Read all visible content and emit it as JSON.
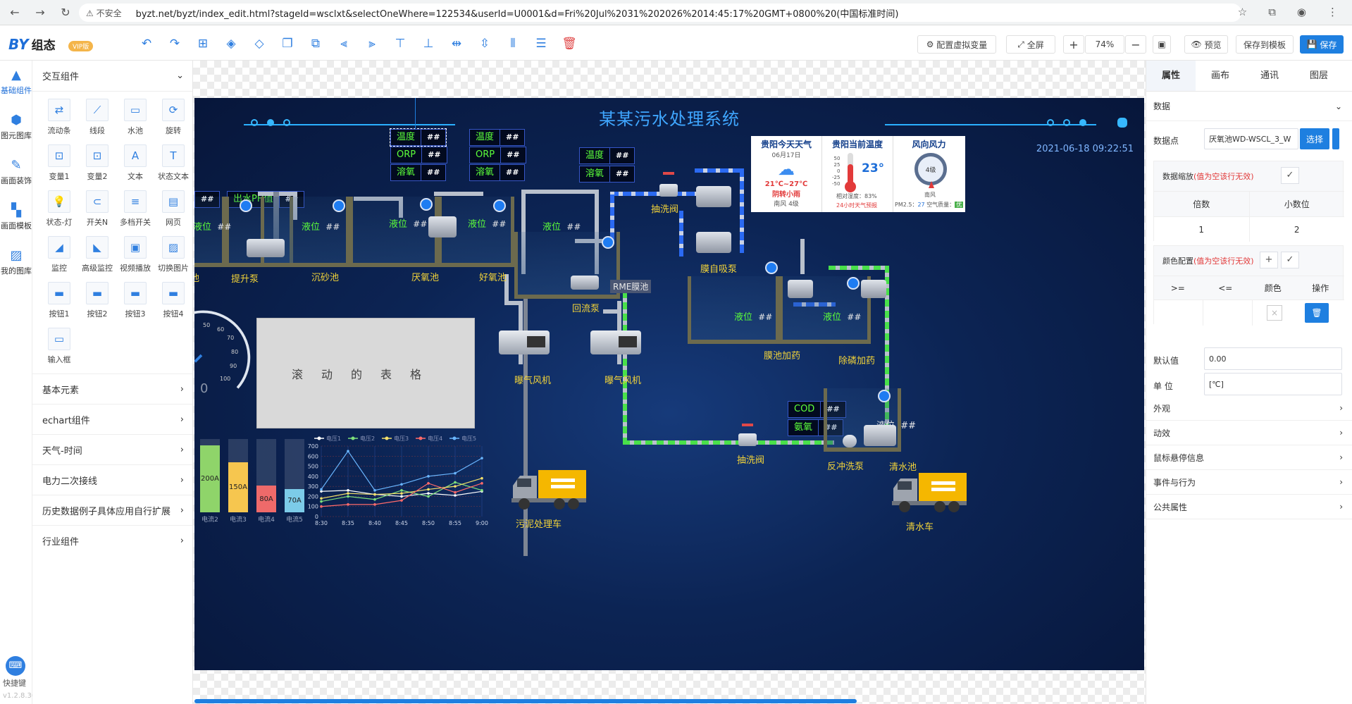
{
  "browser": {
    "back": "←",
    "forward": "→",
    "reload": "↻",
    "insecure": "不安全",
    "url": "byzt.net/byzt/index_edit.html?stageId=wsclxt&selectOneWhere=122534&userId=U0001&d=Fri%20Jul%2031%202026%2014:45:17%20GMT+0800%20(中国标准时间)"
  },
  "toolbar": {
    "logo": "BY",
    "logo_suffix": "组态",
    "vip": "VIP版",
    "virtual_vars": "配置虚拟变量",
    "fullscreen": "全屏",
    "zoom_in": "+",
    "zoom": "74%",
    "zoom_out": "−",
    "preview": "预览",
    "save_template": "保存到模板",
    "save": "保存"
  },
  "rail": [
    {
      "label": "基础组件",
      "icon": "triangle-icon"
    },
    {
      "label": "图元图库",
      "icon": "cube-icon"
    },
    {
      "label": "画面装饰",
      "icon": "brush-icon"
    },
    {
      "label": "画面模板",
      "icon": "template-icon"
    },
    {
      "label": "我的图库",
      "icon": "image-icon"
    }
  ],
  "shortcut": "快捷键",
  "version": "v1.2.8.36",
  "palette": {
    "header": "交互组件",
    "items": [
      "流动条",
      "线段",
      "水池",
      "旋转",
      "变量1",
      "变量2",
      "文本",
      "状态文本",
      "状态-灯",
      "开关N",
      "多档开关",
      "网页",
      "监控",
      "高级监控",
      "视频播放",
      "切换图片",
      "按钮1",
      "按钮2",
      "按钮3",
      "按钮4",
      "输入框"
    ],
    "sections": [
      "基本元素",
      "echart组件",
      "天气-时间",
      "电力二次接线",
      "历史数据例子具体应用自行扩展",
      "行业组件"
    ]
  },
  "scada": {
    "title": "某某污水处理系统",
    "datetime": "2021-06-18  09:22:51",
    "placeholder": "##",
    "tags": {
      "temp": "温度",
      "orp": "ORP",
      "do": "溶氧",
      "ph": "出水PH值",
      "cod": "COD",
      "nh": "氨氧"
    },
    "level": "液位",
    "basins": [
      "池",
      "提升泵",
      "沉砂池",
      "厌氧池",
      "好氧池",
      "回流泵",
      "RME膜池",
      "膜自吸泵",
      "膜池加药",
      "除磷加药",
      "清水池",
      "抽洗阀",
      "抽洗阀",
      "反冲洗泵"
    ],
    "blowers": [
      "曝气风机",
      "曝气风机"
    ],
    "sludge": "污泥",
    "rolling": "滚动的表格",
    "gauge_zero": "0",
    "gauge_ticks": [
      "50",
      "60",
      "70",
      "80",
      "90",
      "100"
    ],
    "trucks": [
      "污泥处理车",
      "清水车"
    ],
    "weather": {
      "today_title": "贵阳今天天气",
      "today_date": "06月17日",
      "today_temp": "21℃~27℃",
      "today_desc": "阴转小雨",
      "today_wind": "南风 4级",
      "now_title": "贵阳当前温度",
      "now_temp": "23°",
      "humidity": "相对湿度：83%",
      "warning": "24小时天气预报",
      "wind_title": "风向风力",
      "wind_level": "4级",
      "wind_dir": "南风",
      "pm": "PM2.5：",
      "pm_val": "27",
      "aq": "空气质量：",
      "aq_val": "优",
      "therm_ticks": [
        "50",
        "25",
        "0",
        "-25",
        "-50"
      ]
    }
  },
  "bar_chart": {
    "categories": [
      "电流2",
      "电流3",
      "电流4",
      "电流5"
    ],
    "values": [
      "200A",
      "150A",
      "80A",
      "70A"
    ],
    "colors": [
      "#8fd46a",
      "#f6c64f",
      "#ee6a6a",
      "#7ccbe8"
    ]
  },
  "chart_data": {
    "type": "line",
    "x": [
      "8:30",
      "8:35",
      "8:40",
      "8:45",
      "8:50",
      "8:55",
      "9:00"
    ],
    "ylim": [
      0,
      700
    ],
    "yticks": [
      "700",
      "600",
      "500",
      "400",
      "300",
      "200",
      "100",
      "0"
    ],
    "series": [
      {
        "name": "电压1",
        "color": "#ffffff",
        "values": [
          250,
          260,
          220,
          200,
          230,
          210,
          250
        ]
      },
      {
        "name": "电压2",
        "color": "#7ee07b",
        "values": [
          150,
          200,
          170,
          260,
          200,
          340,
          260
        ]
      },
      {
        "name": "电压3",
        "color": "#f4e06a",
        "values": [
          180,
          230,
          220,
          230,
          270,
          300,
          380
        ]
      },
      {
        "name": "电压4",
        "color": "#ff6a6a",
        "values": [
          100,
          120,
          120,
          160,
          330,
          240,
          330
        ]
      },
      {
        "name": "电压5",
        "color": "#6ab6ff",
        "values": [
          270,
          650,
          260,
          320,
          400,
          430,
          580
        ]
      }
    ]
  },
  "rpanel": {
    "tabs": [
      "属性",
      "画布",
      "通讯",
      "图层"
    ],
    "data_section": "数据",
    "datapoint_label": "数据点",
    "datapoint_value": "厌氧池WD-WSCL_3_W",
    "select_btn": "选择",
    "scale_label": "数据缩放",
    "scale_note": "(值为空该行无效)",
    "col_mult": "倍数",
    "col_dec": "小数位",
    "mult_val": "1",
    "dec_val": "2",
    "color_label": "颜色配置",
    "color_note": "(值为空该行无效)",
    "col_ge": ">=",
    "col_le": "<=",
    "col_color": "颜色",
    "col_op": "操作",
    "default_label": "默认值",
    "default_val": "0.00",
    "unit_label": "单 位",
    "unit_val": "[℃]",
    "sections": [
      "外观",
      "动效",
      "鼠标悬停信息",
      "事件与行为",
      "公共属性"
    ]
  }
}
